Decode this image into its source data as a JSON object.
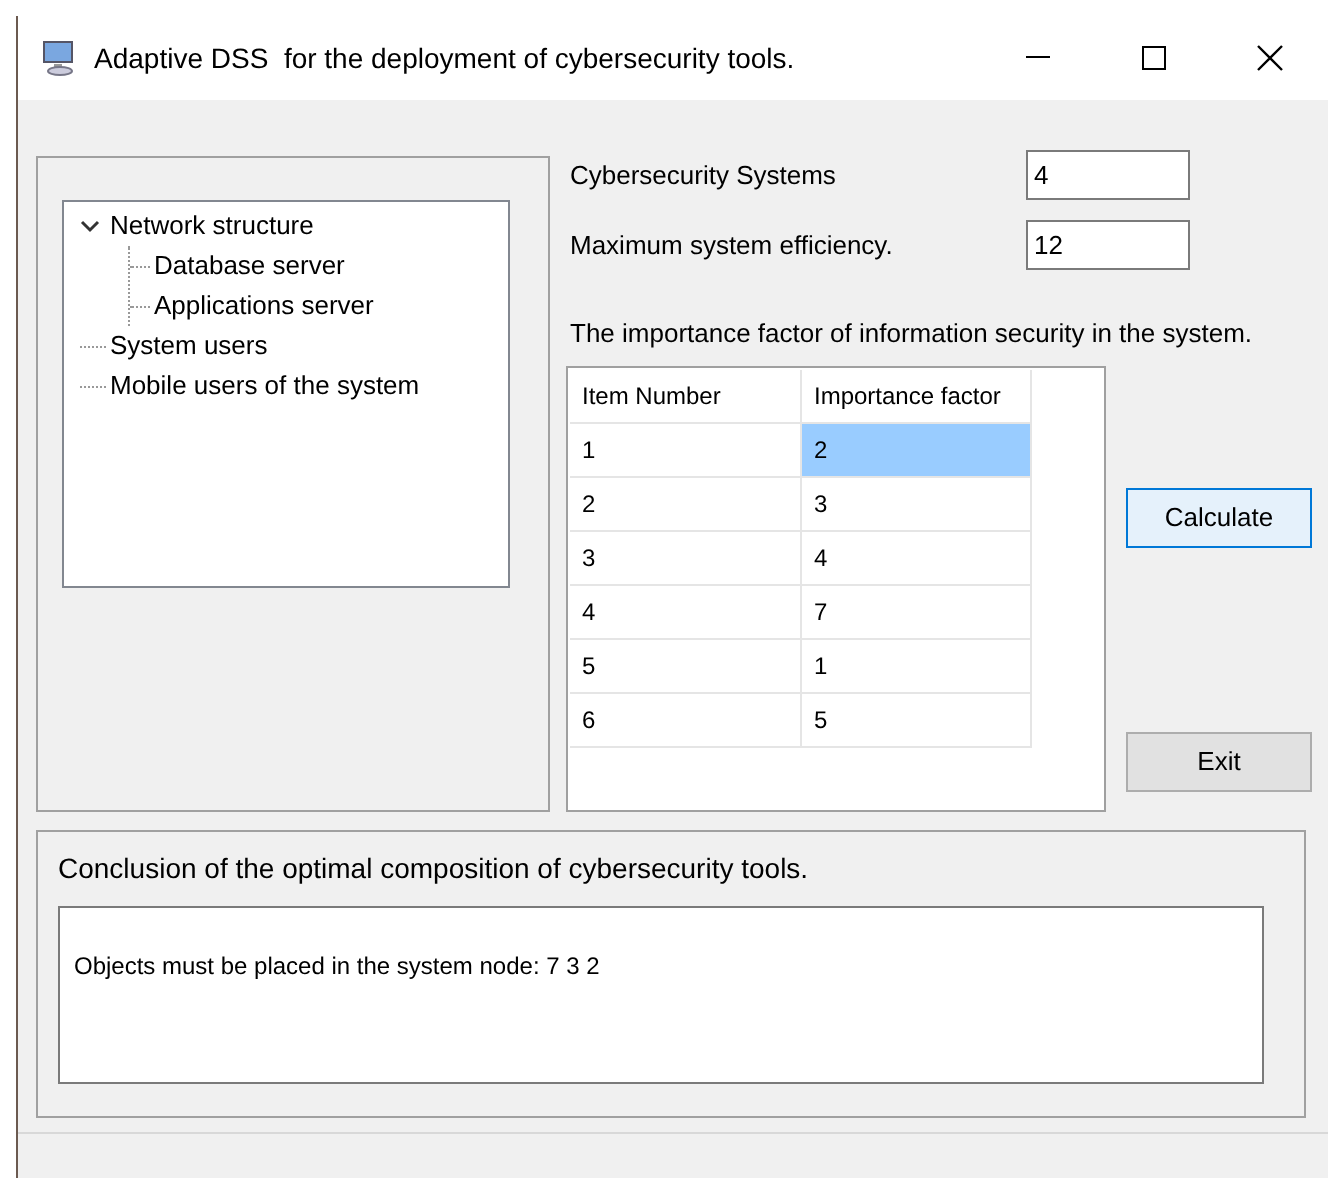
{
  "window": {
    "title": "Adaptive DSS  for the deployment of cybersecurity tools."
  },
  "tree": [
    {
      "label": "Network structure",
      "expanded": true,
      "children": [
        {
          "label": "Database server"
        },
        {
          "label": "Applications server"
        }
      ]
    },
    {
      "label": "System users"
    },
    {
      "label": "Mobile users of the system"
    }
  ],
  "fields": [
    {
      "label": "Cybersecurity Systems",
      "value": "4"
    },
    {
      "label": "Maximum system efficiency.",
      "value": "12"
    }
  ],
  "table": {
    "caption": "The importance factor of information security in the system.",
    "columns": [
      "Item Number",
      "Importance factor"
    ],
    "rows": [
      {
        "item": "1",
        "factor": "2",
        "selected": true
      },
      {
        "item": "2",
        "factor": "3",
        "selected": false
      },
      {
        "item": "3",
        "factor": "4",
        "selected": false
      },
      {
        "item": "4",
        "factor": "7",
        "selected": false
      },
      {
        "item": "5",
        "factor": "1",
        "selected": false
      },
      {
        "item": "6",
        "factor": "5",
        "selected": false
      }
    ]
  },
  "buttons": [
    {
      "label": "Calculate",
      "focused": true
    },
    {
      "label": "Exit",
      "focused": false
    }
  ],
  "conclusion": {
    "title": "Conclusion of the optimal composition of cybersecurity tools.",
    "text": "Objects must be placed in the system node: 7 3 2"
  }
}
